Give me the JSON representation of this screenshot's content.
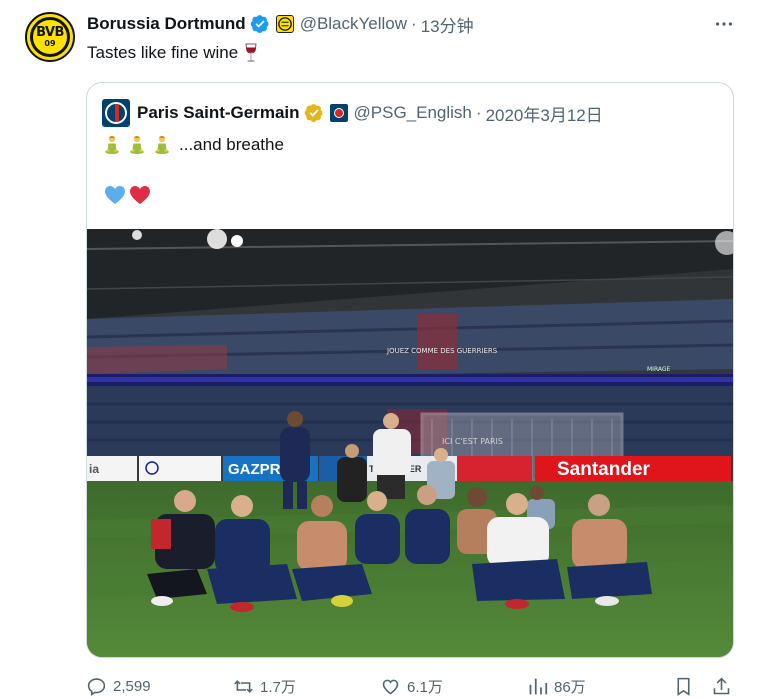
{
  "tweet": {
    "display_name": "Borussia Dortmund",
    "avatar_text": "BVB",
    "avatar_subtext": "09",
    "handle": "@BlackYellow",
    "separator": "·",
    "time": "13分钟",
    "text": "Tastes like fine wine",
    "icons": {
      "more": "more-icon",
      "verified": "verified-badge-icon",
      "wine": "wine-glass-icon"
    }
  },
  "quote": {
    "display_name": "Paris Saint-Germain",
    "handle": "@PSG_English",
    "separator": "·",
    "date": "2020年3月12日",
    "text": "...and breathe",
    "emoji": [
      "person-in-lotus-position",
      "person-in-lotus-position",
      "person-in-lotus-position"
    ],
    "hearts": [
      "blue-heart",
      "red-heart"
    ],
    "photo": {
      "banner_left": "GAZPROM",
      "banner_right": "Santander",
      "banner_mid": "TAG HEUER",
      "banner_left_edge": "ia",
      "stand_text": "JOUEZ COMME DES GUERRIERS",
      "advert_far": "MIRAGE",
      "goal_text": "ICI C'EST PARIS"
    }
  },
  "actions": {
    "reply": "2,599",
    "retweet": "1.7万",
    "like": "6.1万",
    "views": "86万"
  },
  "colors": {
    "text_primary": "#0f1419",
    "text_secondary": "#536471",
    "border": "#cfd9de",
    "verified_blue": "#1d9bf0",
    "verified_gold": "#e2b719",
    "bvb_yellow": "#fde100",
    "psg_navy": "#004170",
    "psg_red": "#da291c"
  }
}
